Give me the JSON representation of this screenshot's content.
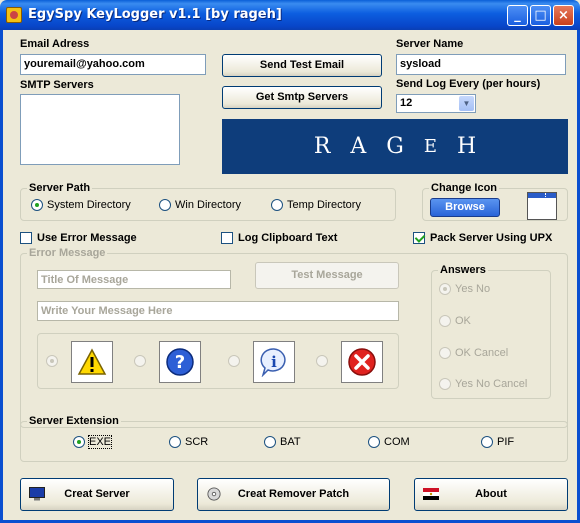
{
  "window": {
    "title": "EgySpy  KeyLogger v1.1  [by rageh]",
    "minimize": "_",
    "maximize": "□",
    "close": "×"
  },
  "email": {
    "label": "Email Adress",
    "value": "youremail@yahoo.com"
  },
  "smtp": {
    "label": "SMTP Servers",
    "value": ""
  },
  "buttons": {
    "send_test": "Send Test Email",
    "get_smtp": "Get Smtp Servers",
    "test_message": "Test Message",
    "browse": "Browse",
    "create_server": "Creat Server",
    "create_remover": "Creat Remover Patch",
    "about": "About"
  },
  "server_name": {
    "label": "Server Name",
    "value": "sysload"
  },
  "send_log": {
    "label": "Send Log Every  (per hours)",
    "value": "12"
  },
  "banner": {
    "letters": [
      "R",
      "A",
      "G",
      "E",
      "H"
    ]
  },
  "server_path": {
    "legend": "Server Path",
    "options": [
      "System Directory",
      "Win Directory",
      "Temp Directory"
    ],
    "selected": 0
  },
  "change_icon": {
    "legend": "Change Icon"
  },
  "checks": {
    "use_error": "Use Error Message",
    "log_clipboard": "Log Clipboard Text",
    "pack_upx": "Pack Server Using UPX",
    "use_error_checked": false,
    "log_clipboard_checked": false,
    "pack_upx_checked": true
  },
  "error_message": {
    "legend": "Error Message",
    "title_placeholder": "Title Of Message",
    "body_placeholder": "Write Your Message Here",
    "icons": [
      "warning-icon",
      "question-icon",
      "info-icon",
      "error-icon"
    ]
  },
  "answers": {
    "legend": "Answers",
    "options": [
      "Yes   No",
      "OK",
      "OK   Cancel",
      "Yes  No  Cancel"
    ]
  },
  "extension": {
    "legend": "Server Extension",
    "options": [
      "EXE",
      "SCR",
      "BAT",
      "COM",
      "PIF"
    ],
    "selected": 0
  },
  "colors": {
    "titlebar": "#0a5fd8",
    "banner": "#0e3d7b",
    "face": "#ece9d8"
  }
}
